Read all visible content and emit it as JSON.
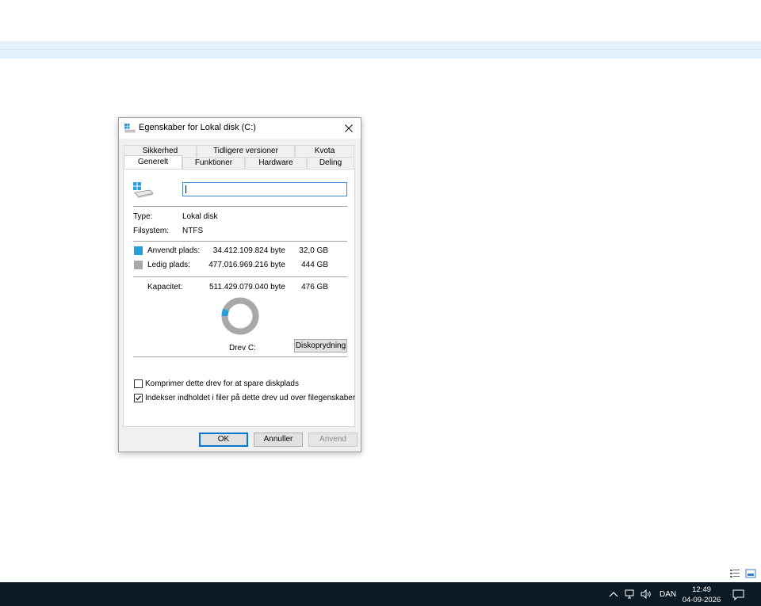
{
  "dialog": {
    "title": "Egenskaber for Lokal disk (C:)",
    "tabs_top": [
      "Sikkerhed",
      "Tidligere versioner",
      "Kvota"
    ],
    "tabs_bottom": [
      "Generelt",
      "Funktioner",
      "Hardware",
      "Deling"
    ],
    "active_tab": "Generelt",
    "name_value": "",
    "type_label": "Type:",
    "type_value": "Lokal disk",
    "fs_label": "Filsystem:",
    "fs_value": "NTFS",
    "used_label": "Anvendt plads:",
    "used_bytes": "34.412.109.824 byte",
    "used_gb": "32,0 GB",
    "free_label": "Ledig plads:",
    "free_bytes": "477.016.969.216 byte",
    "free_gb": "444 GB",
    "capacity_label": "Kapacitet:",
    "capacity_bytes": "511.429.079.040 byte",
    "capacity_gb": "476 GB",
    "drive_label": "Drev C:",
    "cleanup_button": "Diskoprydning",
    "compress_label": "Komprimer dette drev for at spare diskplads",
    "compress_checked": false,
    "index_label": "Indekser indholdet i filer på dette drev ud over filegenskaber",
    "index_checked": true,
    "ok_button": "OK",
    "cancel_button": "Annuller",
    "apply_button": "Anvend",
    "used_fraction": 0.067,
    "colors": {
      "used": "#26a0da",
      "free": "#a8a8a8"
    }
  },
  "taskbar": {
    "language": "DAN",
    "time": "12:49",
    "date": "04-09-2026"
  }
}
